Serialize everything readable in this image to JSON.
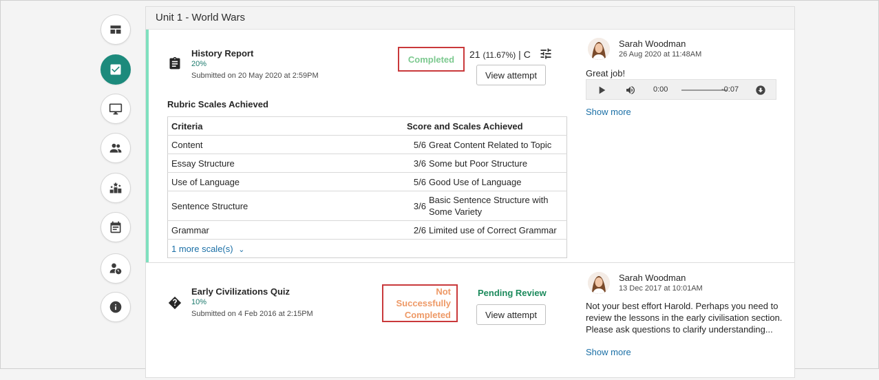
{
  "sidebar": {
    "items": [
      {
        "name": "dashboard-icon",
        "active": false
      },
      {
        "name": "checklist-icon",
        "active": true
      },
      {
        "name": "monitor-icon",
        "active": false
      },
      {
        "name": "people-icon",
        "active": false
      },
      {
        "name": "leaderboard-icon",
        "active": false
      },
      {
        "name": "calendar-icon",
        "active": false
      },
      {
        "name": "user-clock-icon",
        "active": false
      },
      {
        "name": "info-icon",
        "active": false
      }
    ]
  },
  "unit": {
    "title": "Unit 1 - World Wars"
  },
  "activities": [
    {
      "icon": "clipboard-icon",
      "title": "History Report",
      "percent": "20%",
      "submitted": "Submitted on 20 May 2020 at 2:59PM",
      "status": "Completed",
      "score_main": "21",
      "score_pct": "(11.67%)",
      "score_grade": "| C",
      "view_label": "View attempt",
      "rubric": {
        "heading": "Rubric Scales Achieved",
        "col_criteria": "Criteria",
        "col_score": "Score and Scales Achieved",
        "rows": [
          {
            "criteria": "Content",
            "score": "5/6",
            "scale": "Great Content Related to Topic"
          },
          {
            "criteria": "Essay Structure",
            "score": "3/6",
            "scale": "Some but Poor Structure"
          },
          {
            "criteria": "Use of Language",
            "score": "5/6",
            "scale": "Good Use of Language"
          },
          {
            "criteria": "Sentence Structure",
            "score": "3/6",
            "scale": "Basic Sentence Structure with Some Variety"
          },
          {
            "criteria": "Grammar",
            "score": "2/6",
            "scale": "Limited use of Correct Grammar"
          }
        ],
        "more": "1 more scale(s)"
      },
      "feedback": {
        "name": "Sarah Woodman",
        "date": "26 Aug 2020 at 11:48AM",
        "text": "Great job!",
        "audio_start": "0:00",
        "audio_end": "-0:07",
        "show_more": "Show more"
      }
    },
    {
      "icon": "quiz-diamond-icon",
      "title": "Early Civilizations Quiz",
      "percent": "10%",
      "submitted": "Submitted on 4 Feb 2016 at 2:15PM",
      "status_line1": "Not Successfully",
      "status_line2": "Completed",
      "pending": "Pending Review",
      "view_label": "View attempt",
      "feedback": {
        "name": "Sarah Woodman",
        "date": "13 Dec 2017 at 10:01AM",
        "text": "Not your best effort Harold. Perhaps you need to review the lessons in the early civilisation section. Please ask questions to clarify understanding...",
        "show_more": "Show more"
      }
    }
  ]
}
